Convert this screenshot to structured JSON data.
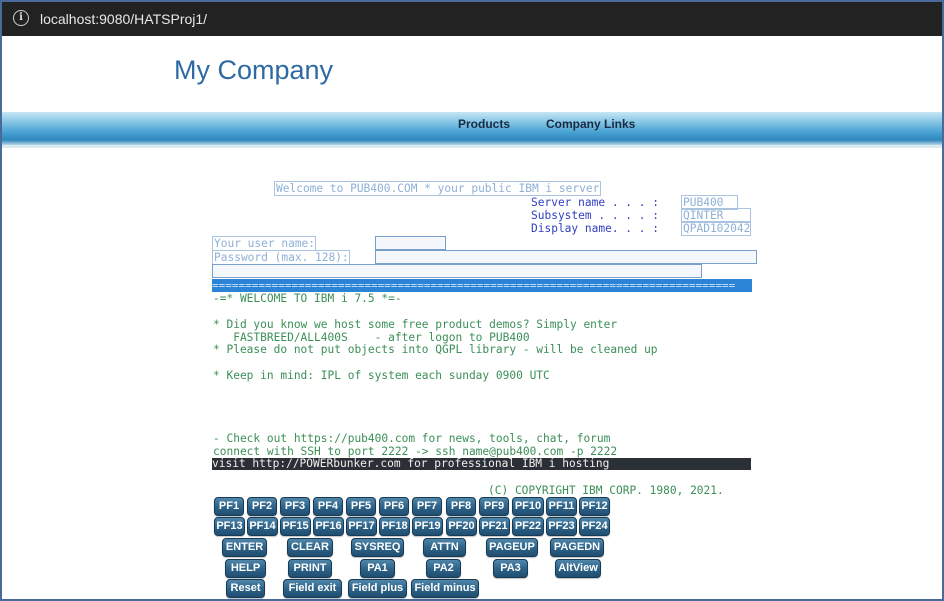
{
  "browser": {
    "url": "localhost:9080/HATSProj1/",
    "info_icon": "i"
  },
  "header": {
    "company": "My Company"
  },
  "nav": {
    "products": "Products",
    "company_links": "Company Links"
  },
  "screen": {
    "welcome": "Welcome to PUB400.COM * your public IBM i server",
    "server_label": "Server name . . . :",
    "server_value": "PUB400",
    "subsystem_label": "Subsystem . . . . :",
    "subsystem_value": "QINTER",
    "display_label": "Display name. . . :",
    "display_value": "QPAD102042",
    "user_label": "Your user name:",
    "password_label": "Password (max. 128):",
    "separator": "===============================================================================",
    "line1": "-=* WELCOME TO IBM i 7.5 *=-",
    "line2": "* Did you know we host some free product demos? Simply enter",
    "line3": "   FASTBREED/ALL400S    - after logon to PUB400",
    "line4": "* Please do not put objects into QGPL library - will be cleaned up",
    "line5": "* Keep in mind: IPL of system each sunday 0900 UTC",
    "line6": "- Check out https://pub400.com for news, tools, chat, forum",
    "line7": "connect with SSH to port 2222 -> ssh name@pub400.com -p 2222",
    "line8": "visit http://POWERbunker.com for professional IBM i hosting",
    "copyright": "(C) COPYRIGHT IBM CORP. 1980, 2021."
  },
  "keys": {
    "row1": [
      "PF1",
      "PF2",
      "PF3",
      "PF4",
      "PF5",
      "PF6",
      "PF7",
      "PF8",
      "PF9",
      "PF10",
      "PF11",
      "PF12"
    ],
    "row2": [
      "PF13",
      "PF14",
      "PF15",
      "PF16",
      "PF17",
      "PF18",
      "PF19",
      "PF20",
      "PF21",
      "PF22",
      "PF23",
      "PF24"
    ],
    "row3": [
      "ENTER",
      "CLEAR",
      "SYSREQ",
      "ATTN",
      "PAGEUP",
      "PAGEDN"
    ],
    "row4": [
      "HELP",
      "PRINT",
      "PA1",
      "PA2",
      "PA3",
      "AltView"
    ],
    "row5": [
      "Reset",
      "Field exit",
      "Field plus",
      "Field minus"
    ]
  },
  "colors": {
    "brand": "#2d6aa3",
    "nav_gradient_mid": "#4aa3d4",
    "button": "#2f6489",
    "separator_bar": "#2c84d6",
    "field_text": "#3b8f57"
  }
}
